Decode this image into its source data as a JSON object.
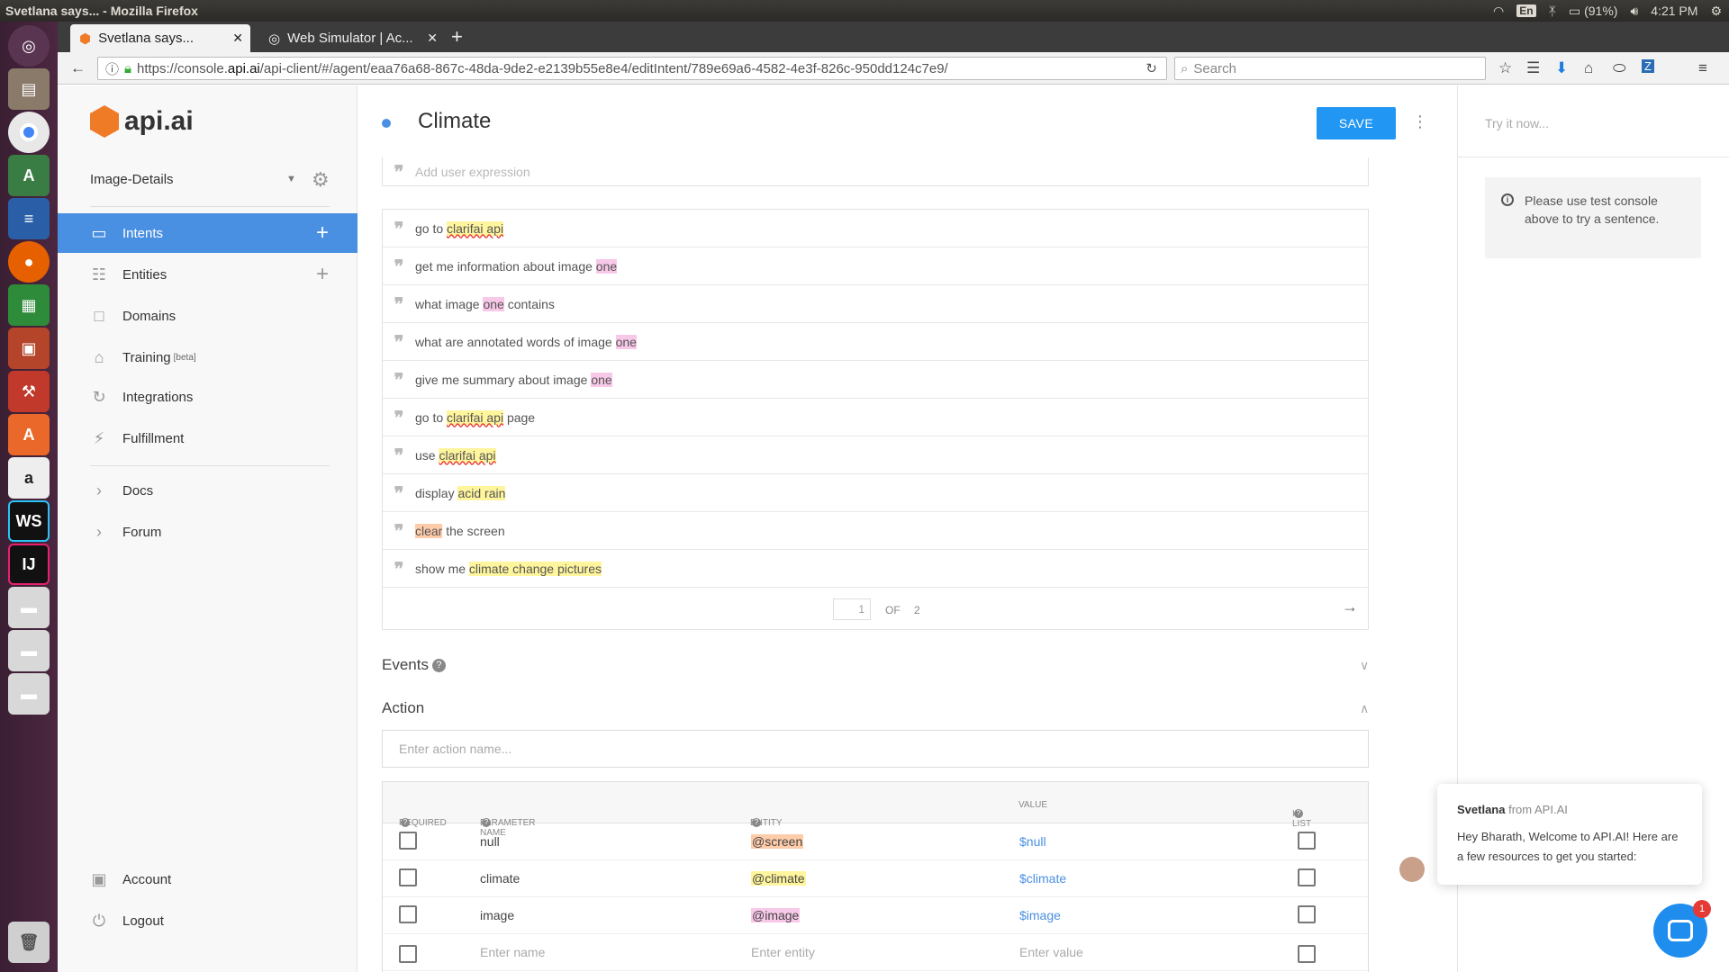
{
  "os": {
    "window_title": "Svetlana says... - Mozilla Firefox",
    "tray": {
      "keyboard": "En",
      "battery": "(91%)",
      "time": "4:21 PM"
    }
  },
  "browser": {
    "tabs": [
      {
        "label": "Svetlana says...",
        "active": true
      },
      {
        "label": "Web Simulator  |  Ac...",
        "active": false
      }
    ],
    "url_prefix": "https://console.",
    "url_domain": "api.ai",
    "url_path": "/api-client/#/agent/eaa76a68-867c-48da-9de2-e2139b55e8e4/editIntent/789e69a6-4582-4e3f-826c-950dd124c7e9/",
    "search_placeholder": "Search"
  },
  "sidebar": {
    "logo_text": "api.ai",
    "agent_name": "Image-Details",
    "items": [
      {
        "label": "Intents",
        "icon": "chat-icon"
      },
      {
        "label": "Entities",
        "icon": "hierarchy-icon"
      },
      {
        "label": "Domains",
        "icon": "book-icon"
      },
      {
        "label": "Training",
        "icon": "graduation-icon",
        "badge": "[beta]"
      },
      {
        "label": "Integrations",
        "icon": "cycle-icon"
      },
      {
        "label": "Fulfillment",
        "icon": "bolt-icon"
      },
      {
        "label": "Docs",
        "icon": "chevron-right-icon"
      },
      {
        "label": "Forum",
        "icon": "chevron-right-icon"
      },
      {
        "label": "Account",
        "icon": "account-icon"
      },
      {
        "label": "Logout",
        "icon": "power-icon"
      }
    ]
  },
  "intent": {
    "title": "Climate",
    "save_label": "SAVE",
    "add_expression_placeholder": "Add user expression",
    "expressions": [
      [
        {
          "t": "go to "
        },
        {
          "t": "clarifai api",
          "hl": "y",
          "u": true
        }
      ],
      [
        {
          "t": "get me information about image "
        },
        {
          "t": "one",
          "hl": "p"
        }
      ],
      [
        {
          "t": "what image "
        },
        {
          "t": "one",
          "hl": "p"
        },
        {
          "t": " contains"
        }
      ],
      [
        {
          "t": "what are annotated words of image "
        },
        {
          "t": "one",
          "hl": "p"
        }
      ],
      [
        {
          "t": "give me summary about image "
        },
        {
          "t": "one",
          "hl": "p"
        }
      ],
      [
        {
          "t": "go to "
        },
        {
          "t": "clarifai api",
          "hl": "y",
          "u": true
        },
        {
          "t": " page"
        }
      ],
      [
        {
          "t": "use "
        },
        {
          "t": "clarifai api",
          "hl": "y",
          "u": true
        }
      ],
      [
        {
          "t": "display "
        },
        {
          "t": "acid rain",
          "hl": "y"
        }
      ],
      [
        {
          "t": "clear",
          "hl": "o"
        },
        {
          "t": " the screen"
        }
      ],
      [
        {
          "t": "show me "
        },
        {
          "t": "climate change pictures",
          "hl": "y"
        }
      ]
    ],
    "pager": {
      "current": "1",
      "of_label": "OF",
      "total": "2"
    },
    "events_title": "Events",
    "action_title": "Action",
    "action_placeholder": "Enter action name...",
    "param_headers": {
      "required": "REQUIRED",
      "name": "PARAMETER NAME",
      "entity": "ENTITY",
      "value": "VALUE",
      "is_list": "IS LIST"
    },
    "params": [
      {
        "name": "null",
        "entity": "@screen",
        "entity_color": "#ffccaa",
        "value": "$null"
      },
      {
        "name": "climate",
        "entity": "@climate",
        "entity_color": "#fff59d",
        "value": "$climate"
      },
      {
        "name": "image",
        "entity": "@image",
        "entity_color": "#f8c8e8",
        "value": "$image"
      }
    ],
    "new_param": {
      "name_placeholder": "Enter name",
      "entity_placeholder": "Enter entity",
      "value_placeholder": "Enter value"
    }
  },
  "right_panel": {
    "try_placeholder": "Try it now...",
    "info_text": "Please use test console above to try a sentence."
  },
  "chat": {
    "sender": "Svetlana",
    "from_label": "from API.AI",
    "message": "Hey Bharath, Welcome to API.AI! Here are a few resources to get you started:",
    "badge": "1"
  },
  "colors": {
    "accent": "#4a90e2",
    "save": "#2196f3",
    "brand": "#f07b27"
  }
}
